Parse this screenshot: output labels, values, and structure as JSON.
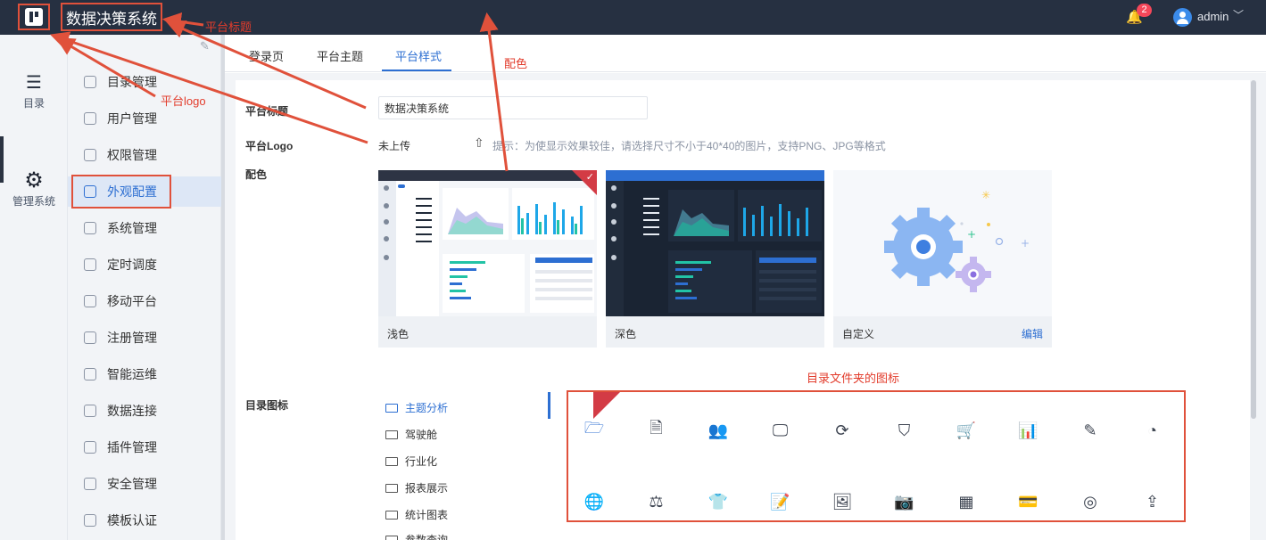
{
  "header": {
    "title": "数据决策系统",
    "notification_count": "2",
    "user_name": "admin"
  },
  "rail": {
    "items": [
      {
        "label": "目录"
      },
      {
        "label": "管理系统"
      }
    ]
  },
  "menu": {
    "items": [
      {
        "label": "目录管理"
      },
      {
        "label": "用户管理"
      },
      {
        "label": "权限管理"
      },
      {
        "label": "外观配置"
      },
      {
        "label": "系统管理"
      },
      {
        "label": "定时调度"
      },
      {
        "label": "移动平台"
      },
      {
        "label": "注册管理"
      },
      {
        "label": "智能运维"
      },
      {
        "label": "数据连接"
      },
      {
        "label": "插件管理"
      },
      {
        "label": "安全管理"
      },
      {
        "label": "模板认证"
      }
    ],
    "active": "外观配置"
  },
  "tabs": [
    {
      "label": "登录页"
    },
    {
      "label": "平台主题"
    },
    {
      "label": "平台样式"
    }
  ],
  "form": {
    "title_label": "平台标题",
    "title_value": "数据决策系统",
    "logo_label": "平台Logo",
    "logo_status": "未上传",
    "logo_hint": "提示：为使显示效果较佳，请选择尺寸不小于40*40的图片，支持PNG、JPG等格式",
    "color_label": "配色",
    "folder_icon_label": "目录图标"
  },
  "themes": [
    {
      "label": "浅色",
      "selected": true
    },
    {
      "label": "深色",
      "selected": false
    },
    {
      "label": "自定义",
      "edit_label": "编辑",
      "selected": false
    }
  ],
  "folders": [
    {
      "label": "主题分析",
      "active": true
    },
    {
      "label": "驾驶舱"
    },
    {
      "label": "行业化"
    },
    {
      "label": "报表展示"
    },
    {
      "label": "统计图表"
    },
    {
      "label": "参数查询"
    }
  ],
  "icon_grid": [
    "folder-icon",
    "document-icon",
    "users-icon",
    "monitor-chart-icon",
    "refresh-cycle-icon",
    "shield-icon",
    "cart-icon",
    "bar-chart-icon",
    "edit-icon",
    "pie-icon",
    "globe-icon",
    "scale-icon",
    "shirt-icon",
    "note-icon",
    "image-icon",
    "camera-icon",
    "grid-icon",
    "card-icon",
    "search-circle-icon",
    "upload-icon"
  ],
  "annotations": {
    "platform_title": "平台标题",
    "platform_logo": "平台logo",
    "color_scheme": "配色",
    "folder_icons": "目录文件夹的图标"
  },
  "colors": {
    "header_bg": "#263041",
    "accent": "#2d6fd2",
    "annotation": "#e23c2c"
  }
}
